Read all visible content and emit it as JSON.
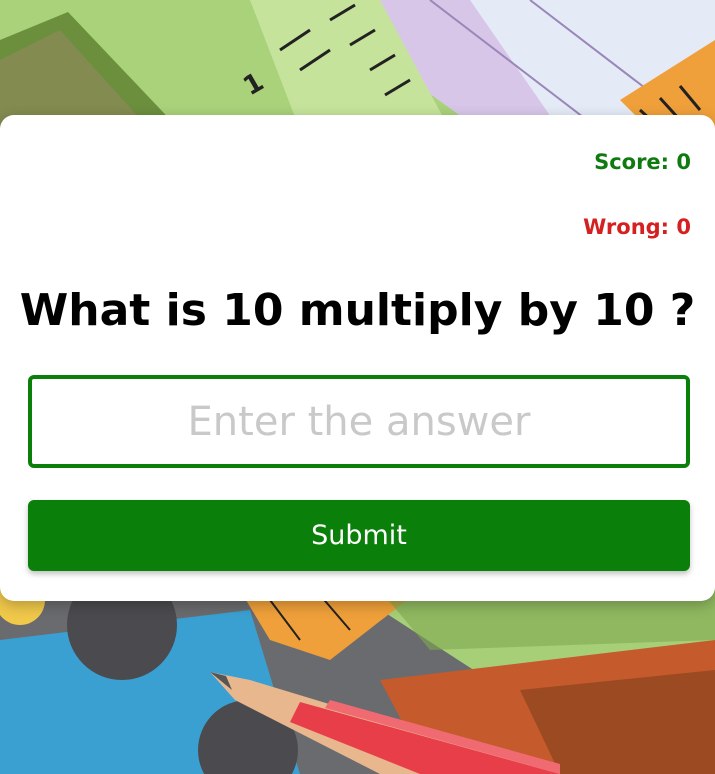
{
  "scoreboard": {
    "score_label": "Score: 0",
    "wrong_label": "Wrong: 0",
    "score_color": "#0f7a0f",
    "wrong_color": "#d42020"
  },
  "quiz": {
    "question": "What is 10 multiply by 10 ?",
    "answer_placeholder": "Enter the answer",
    "answer_value": "",
    "submit_label": "Submit"
  },
  "background": {
    "ruler_mark": "1",
    "icons": [
      "ruler-icon",
      "pencil-icon",
      "set-square-icon"
    ]
  },
  "colors": {
    "accent": "#0a800a",
    "card": "#ffffff",
    "background": "#a9cf79"
  }
}
